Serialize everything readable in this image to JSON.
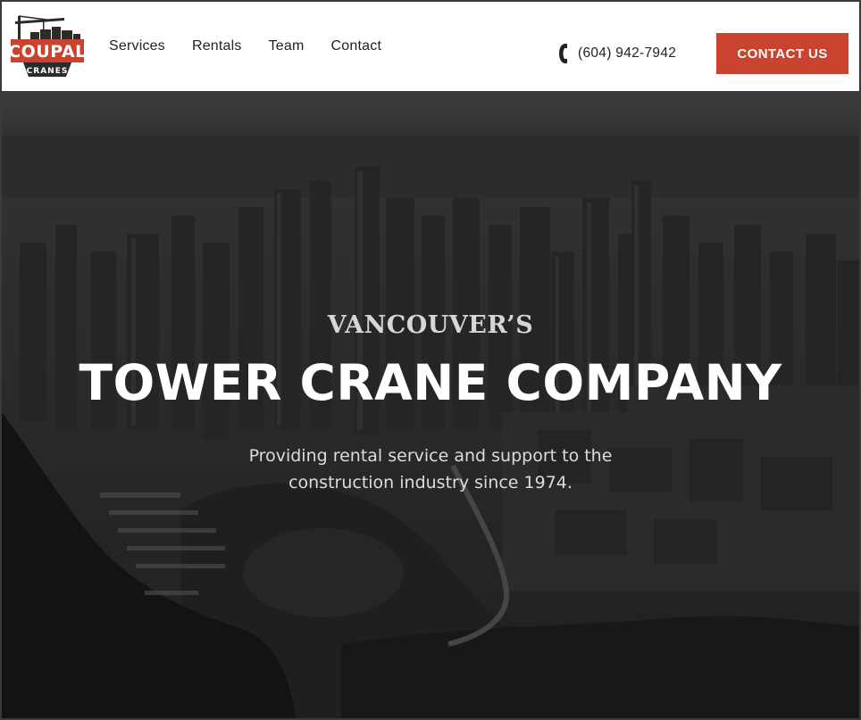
{
  "brand": {
    "logo_line1": "COUPAL",
    "logo_line2": "CRANES",
    "logo_red": "#c9432f",
    "logo_dark": "#2b2b2b"
  },
  "nav": {
    "items": [
      {
        "label": "Services"
      },
      {
        "label": "Rentals"
      },
      {
        "label": "Team"
      },
      {
        "label": "Contact"
      }
    ]
  },
  "header": {
    "phone_icon": "phone-icon",
    "phone": "(604) 942-7942",
    "cta_label": "CONTACT US",
    "cta_color": "#c9432f"
  },
  "hero": {
    "eyebrow": "VANCOUVER’S",
    "headline": "TOWER CRANE COMPANY",
    "tagline": "Providing rental service and support to the construction industry since 1974.",
    "background": "grayscale aerial photo of Vancouver skyline and harbour"
  }
}
